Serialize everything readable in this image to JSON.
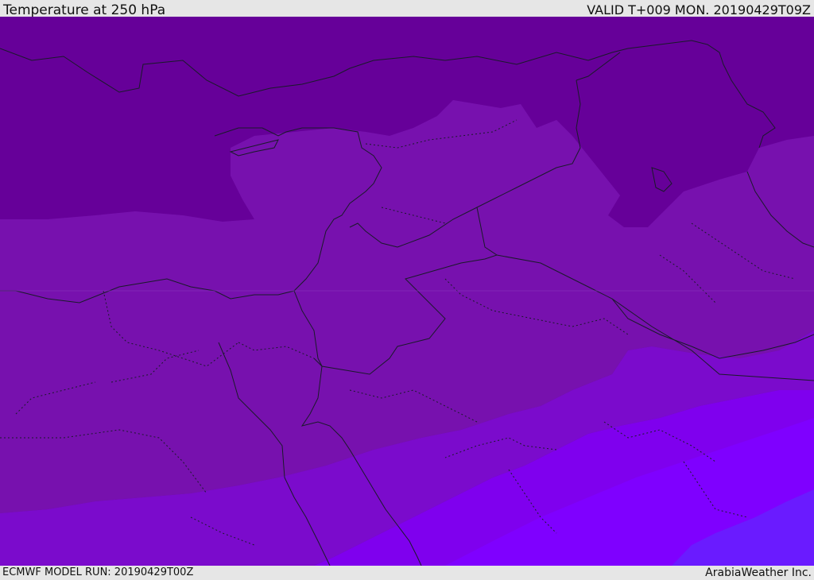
{
  "header": {
    "title": "Temperature at 250 hPa",
    "valid": "VALID T+009 MON. 20190429T09Z"
  },
  "footer": {
    "model_run": "ECMWF MODEL RUN: 20190429T00Z",
    "brand": "ArabiaWeather Inc."
  },
  "map": {
    "colors": {
      "band_coldest": "#660099",
      "band_cold": "#7711ae",
      "band_mid": "#7b0fbf",
      "band_warm": "#7f00e0",
      "band_warmer": "#8000ff",
      "band_warmest": "#6a20ff",
      "borders": "#1a1a2a"
    }
  }
}
